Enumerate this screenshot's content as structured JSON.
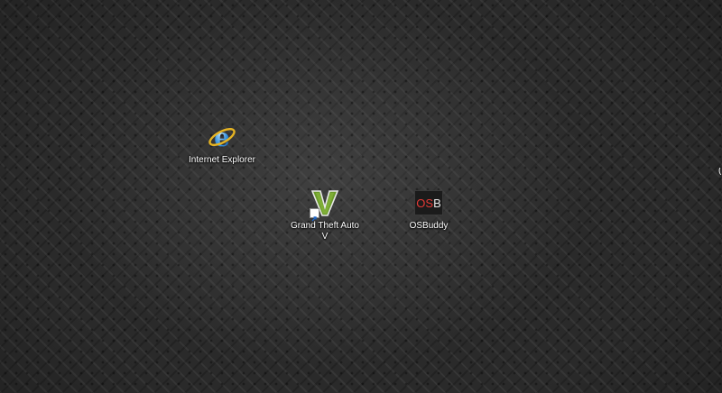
{
  "desktop": {
    "icons": [
      {
        "label": "Internet Explorer",
        "icon": "internet-explorer-icon"
      },
      {
        "label": "Grand Theft Auto V",
        "icon": "gta-v-icon"
      },
      {
        "label": "OSBuddy",
        "icon": "osbuddy-icon",
        "logo_text_red": "OS",
        "logo_text_white": "B"
      }
    ]
  },
  "colors": {
    "background": "#2a2a2a",
    "label_text": "#ffffff",
    "osb_red": "#e53935",
    "gta_green": "#6a9a2a",
    "ie_blue": "#1e73c8",
    "ie_ring": "#e6b422"
  }
}
